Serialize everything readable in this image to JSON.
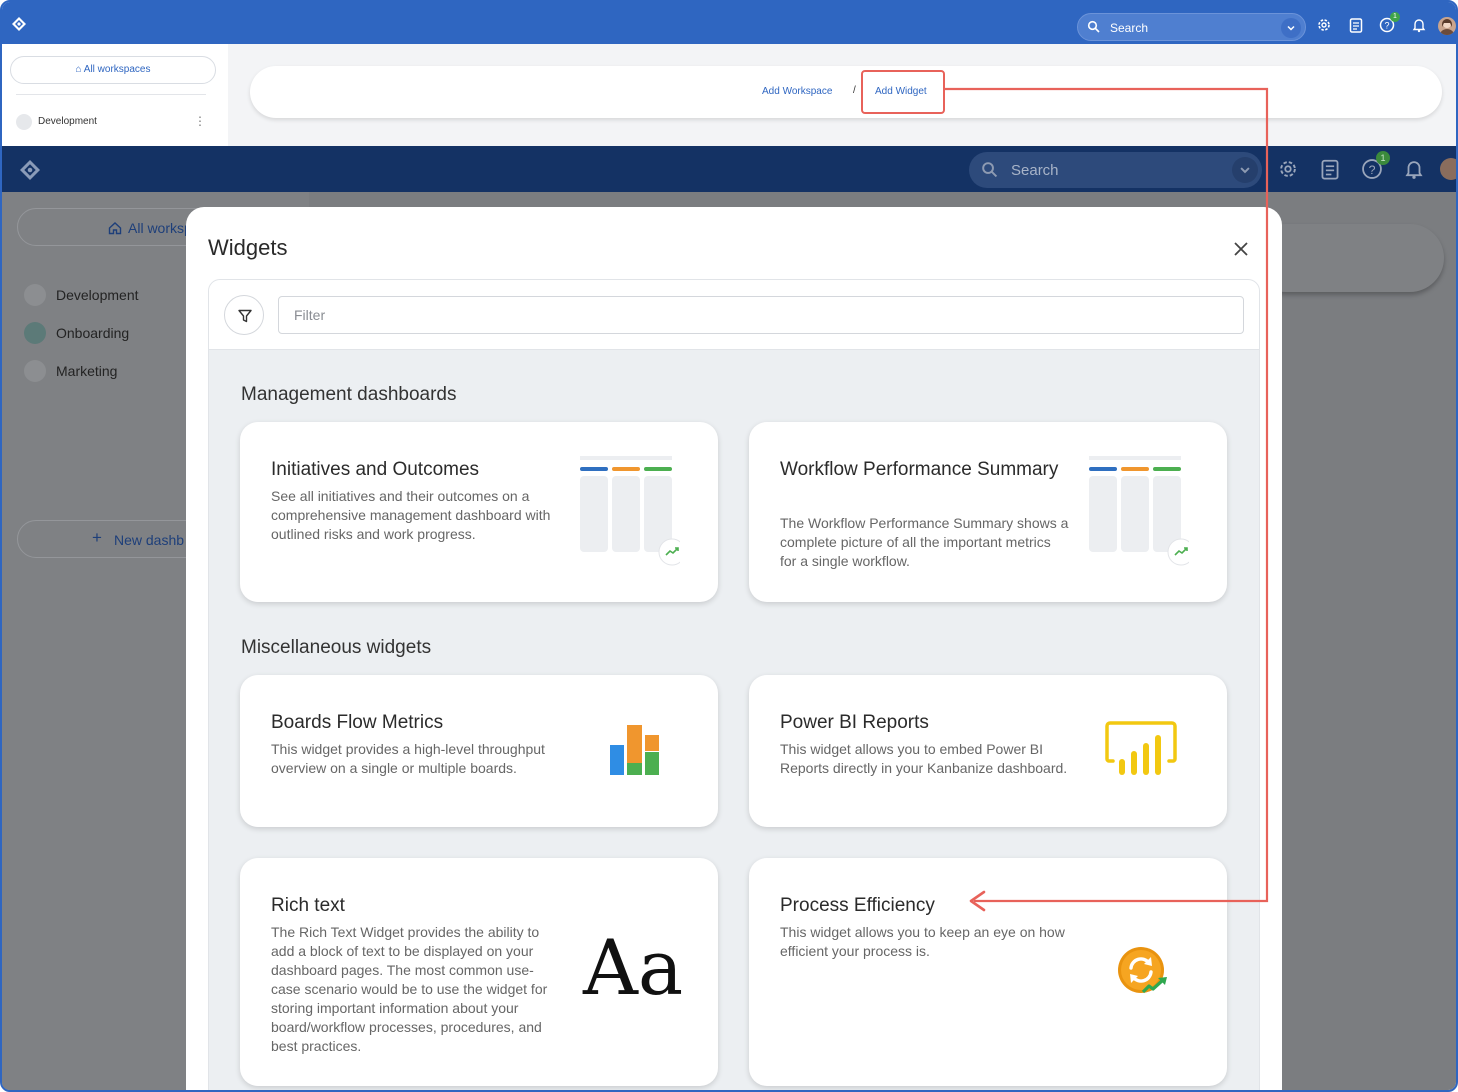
{
  "top_app": {
    "search_placeholder": "Search",
    "notification_badge": "1",
    "sidebar": {
      "all_workspaces_label": "All workspaces",
      "workspace_item": "Development"
    },
    "breadcrumb": {
      "items": [
        "Add Workspace",
        "Add Widget"
      ],
      "separator": "/"
    }
  },
  "bottom_app": {
    "search_placeholder": "Search",
    "notification_badge": "1",
    "sidebar": {
      "all_workspaces_label": "All worksp",
      "workspaces": [
        {
          "label": "Development",
          "color": "#8c8e91"
        },
        {
          "label": "Onboarding",
          "color": "#5c7a78"
        },
        {
          "label": "Marketing",
          "color": "#8c8e91"
        }
      ],
      "new_dashboard_label": "New dashb"
    }
  },
  "modal": {
    "title": "Widgets",
    "filter_placeholder": "Filter",
    "sections": [
      {
        "heading": "Management dashboards",
        "cards": [
          {
            "title": "Initiatives and Outcomes",
            "description": "See all initiatives and their outcomes on a comprehensive management dashboard with outlined risks and work progress.",
            "icon": "dashboard-columns-icon"
          },
          {
            "title": "Workflow Performance Summary",
            "description": "The Workflow Performance Summary shows a complete picture of all the important metrics for a single workflow.",
            "icon": "dashboard-columns-icon"
          }
        ]
      },
      {
        "heading": "Miscellaneous widgets",
        "cards": [
          {
            "title": "Boards Flow Metrics",
            "description": "This widget provides a high-level throughput overview on a single or multiple boards.",
            "icon": "stacked-bars-icon"
          },
          {
            "title": "Power BI Reports",
            "description": "This widget allows you to embed Power BI Reports directly in your Kanbanize dashboard.",
            "icon": "power-bi-icon"
          },
          {
            "title": "Rich text",
            "description": "The Rich Text Widget provides the ability to add a block of text to be displayed on your dashboard pages. The most common use-case scenario would be to use the widget for storing important information about your board/workflow processes, procedures, and best practices.",
            "icon": "rich-text-icon",
            "icon_text": "Aa"
          },
          {
            "title": "Process Efficiency",
            "description": "This widget allows you to keep an eye on how efficient your process is.",
            "icon": "process-efficiency-icon"
          }
        ]
      }
    ]
  },
  "colors": {
    "brand_blue": "#2f66c1",
    "dark_navy": "#143264",
    "annotation_red": "#e8625a",
    "bar_blue": "#2f6fc0",
    "bar_orange": "#f0962e",
    "bar_green": "#4caf50",
    "power_bi_yellow": "#f2c811"
  }
}
